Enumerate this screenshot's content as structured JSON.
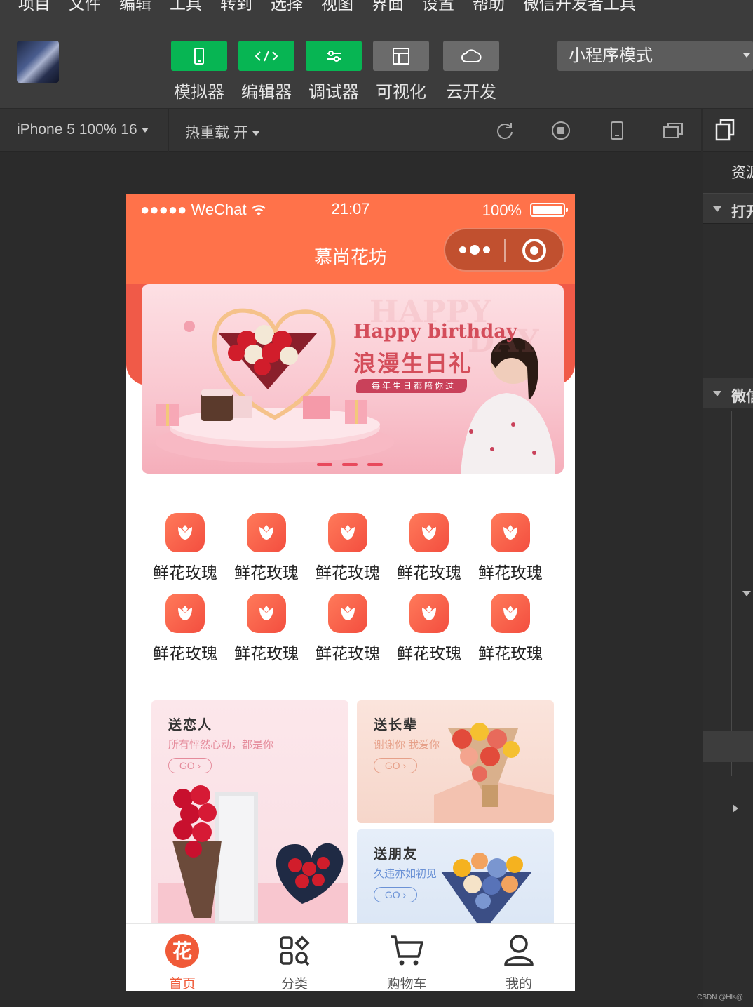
{
  "menu": [
    "项目",
    "文件",
    "编辑",
    "工具",
    "转到",
    "选择",
    "视图",
    "界面",
    "设置",
    "帮助",
    "微信开发者工具"
  ],
  "toolbar": {
    "tools": [
      {
        "label": "模拟器",
        "icon": "phone-icon",
        "style": "green"
      },
      {
        "label": "编辑器",
        "icon": "code-icon",
        "style": "green"
      },
      {
        "label": "调试器",
        "icon": "sliders-icon",
        "style": "green"
      },
      {
        "label": "可视化",
        "icon": "layout-icon",
        "style": "gray"
      },
      {
        "label": "云开发",
        "icon": "cloud-icon",
        "style": "gray"
      }
    ],
    "mode": "小程序模式"
  },
  "simbar": {
    "device": "iPhone 5 100% 16",
    "hot_reload": "热重载 开"
  },
  "right_panel": {
    "tab": "资源",
    "section1": "打开",
    "section2": "微信"
  },
  "phone": {
    "status": {
      "signal": "●●●●● WeChat",
      "time": "21:07",
      "battery": "100%"
    },
    "nav_title": "慕尚花坊",
    "banner": {
      "watermark1": "HAPPY",
      "watermark2": "DAY",
      "title_en": "Happy birthday",
      "title_cn": "浪漫生日礼",
      "tag": "每年生日都陪你过"
    },
    "categories": [
      "鲜花玫瑰",
      "鲜花玫瑰",
      "鲜花玫瑰",
      "鲜花玫瑰",
      "鲜花玫瑰",
      "鲜花玫瑰",
      "鲜花玫瑰",
      "鲜花玫瑰",
      "鲜花玫瑰",
      "鲜花玫瑰"
    ],
    "cards": [
      {
        "title": "送恋人",
        "subtitle": "所有怦然心动，都是你",
        "go": "GO ›"
      },
      {
        "title": "送长辈",
        "subtitle": "谢谢你 我爱你",
        "go": "GO ›"
      },
      {
        "title": "送朋友",
        "subtitle": "久违亦如初见",
        "go": "GO ›"
      }
    ],
    "tabs": [
      {
        "label": "首页",
        "icon": "home-flower-icon",
        "active": true
      },
      {
        "label": "分类",
        "icon": "category-icon",
        "active": false
      },
      {
        "label": "购物车",
        "icon": "cart-icon",
        "active": false
      },
      {
        "label": "我的",
        "icon": "user-icon",
        "active": false
      }
    ]
  },
  "footer_mark": "CSDN @Hls@",
  "colors": {
    "accent": "#ff724a",
    "tab_active": "#f05a38",
    "green": "#07b553"
  }
}
